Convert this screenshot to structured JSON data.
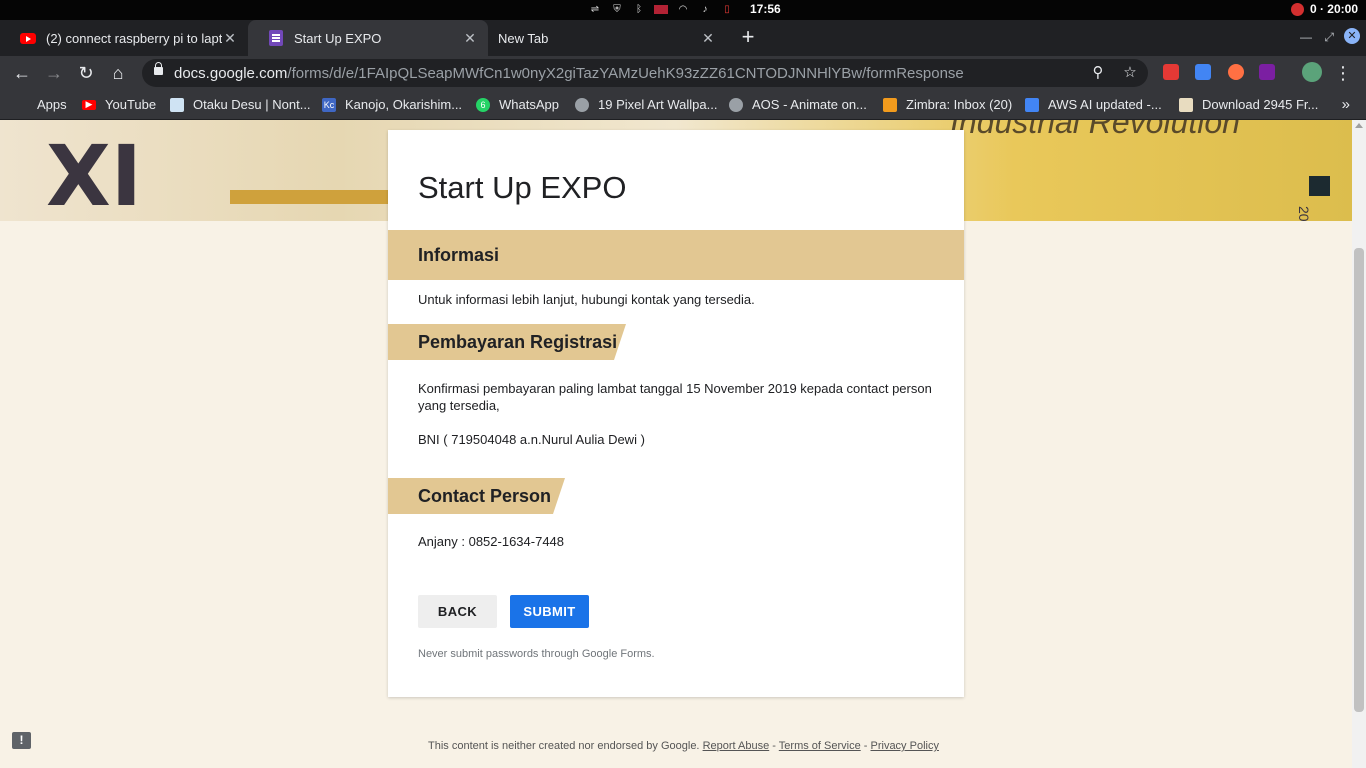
{
  "os": {
    "clock": "17:56",
    "pomodoro": "0 · 20:00"
  },
  "tabs": [
    {
      "title": "(2) connect raspberry pi to lapto",
      "icon": "youtube-icon",
      "active": false
    },
    {
      "title": "Start Up EXPO",
      "icon": "google-forms-icon",
      "active": true
    },
    {
      "title": "New Tab",
      "icon": "",
      "active": false
    }
  ],
  "toolbar": {
    "url_host": "docs.google.com",
    "url_path": "/forms/d/e/1FAIpQLSeapMWfCn1w0nyX2giTazYAMzUehK93zZZ61CNTODJNNHlYBw/formResponse"
  },
  "bookmarks": [
    {
      "label": "Apps",
      "icon": "apps-grid-icon"
    },
    {
      "label": "YouTube",
      "icon": "youtube-icon"
    },
    {
      "label": "Otaku Desu | Nont...",
      "icon": "otakudesu-icon"
    },
    {
      "label": "Kanojo, Okarishim...",
      "icon": "kc-icon",
      "badge": "Kc"
    },
    {
      "label": "WhatsApp",
      "icon": "whatsapp-icon",
      "badge": "6"
    },
    {
      "label": "19 Pixel Art Wallpa...",
      "icon": "globe-icon"
    },
    {
      "label": "AOS - Animate on...",
      "icon": "globe-icon"
    },
    {
      "label": "Zimbra: Inbox (20)",
      "icon": "zimbra-icon"
    },
    {
      "label": "AWS AI updated -...",
      "icon": "docs-icon"
    },
    {
      "label": "Download 2945 Fr...",
      "icon": "download-site-icon"
    }
  ],
  "banner": {
    "big_text": "XI",
    "tagline": "Industrial Revolution",
    "tiny": "20"
  },
  "form": {
    "title": "Start Up EXPO",
    "sections": [
      {
        "heading": "Informasi",
        "body": [
          "Untuk informasi lebih lanjut, hubungi kontak yang tersedia."
        ]
      },
      {
        "heading": "Pembayaran Registrasi",
        "body": [
          "Konfirmasi pembayaran paling lambat tanggal 15 November 2019 kepada contact person yang tersedia,",
          "BNI  ( 719504048 a.n.Nurul Aulia Dewi )"
        ]
      },
      {
        "heading": "Contact Person",
        "body": [
          "Anjany : 0852-1634-7448"
        ]
      }
    ],
    "back_label": "BACK",
    "submit_label": "SUBMIT",
    "password_warning": "Never submit passwords through Google Forms."
  },
  "footer": {
    "text": "This content is neither created nor endorsed by Google.",
    "report_abuse": "Report Abuse",
    "terms": "Terms of Service",
    "privacy": "Privacy Policy",
    "sep": " - "
  },
  "colors": {
    "section_header": "#e2c792",
    "submit": "#1a73e8",
    "page_bg": "#f8f2e6"
  }
}
